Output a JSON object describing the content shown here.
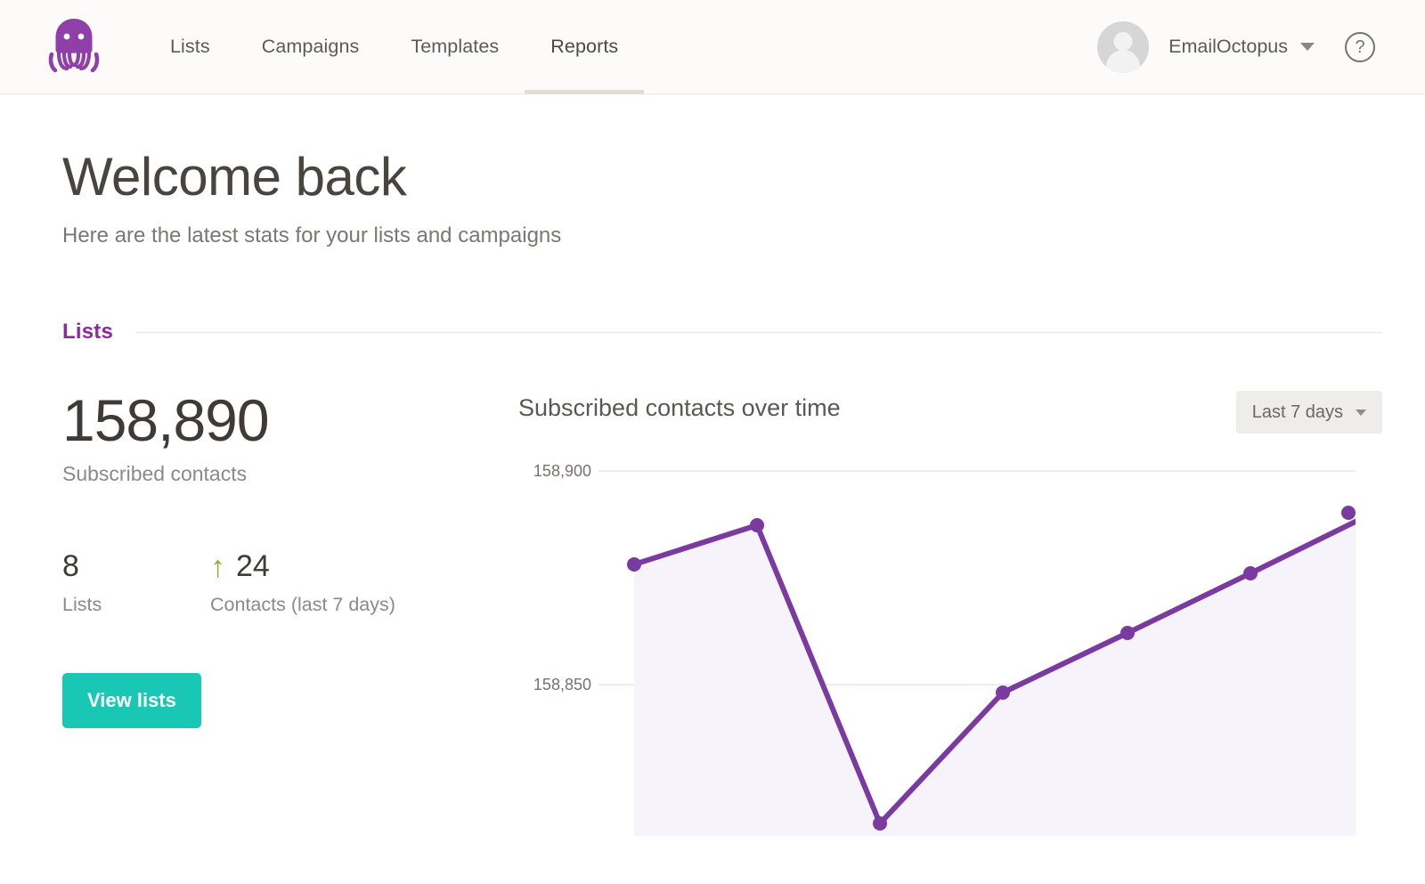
{
  "nav": {
    "logo_icon": "octopus-logo",
    "items": [
      {
        "label": "Lists",
        "active": false
      },
      {
        "label": "Campaigns",
        "active": false
      },
      {
        "label": "Templates",
        "active": false
      },
      {
        "label": "Reports",
        "active": true
      }
    ],
    "account_name": "EmailOctopus",
    "account_caret_icon": "chevron-down-icon",
    "help_icon": "question-mark-icon",
    "avatar_icon": "user-avatar"
  },
  "page": {
    "title": "Welcome back",
    "subtitle": "Here are the latest stats for your lists and campaigns"
  },
  "section": {
    "title": "Lists"
  },
  "stats": {
    "subscribed_value": "158,890",
    "subscribed_label": "Subscribed contacts",
    "lists_value": "8",
    "lists_label": "Lists",
    "contacts_arrow_icon": "arrow-up-icon",
    "contacts_arrow_glyph": "↑",
    "contacts_value": "24",
    "contacts_label": "Contacts (last 7 days)",
    "view_lists_button": "View lists"
  },
  "chart_panel": {
    "title": "Subscribed contacts over time",
    "range_label": "Last 7 days",
    "range_caret_icon": "chevron-down-icon"
  },
  "colors": {
    "brand_purple": "#8e2aa0",
    "line_purple": "#7b3aa0",
    "area_fill": "#f7f3fa",
    "button_teal": "#19c7b5",
    "arrow_green": "#8cb029",
    "topbar_bg": "#fcfbf9",
    "active_tab_underline": "#e3dcd2",
    "gridline": "#e9e6e2"
  },
  "chart_data": {
    "type": "area",
    "title": "Subscribed contacts over time",
    "xlabel": "",
    "ylabel": "",
    "x": [
      1,
      2,
      3,
      4,
      5,
      6,
      7
    ],
    "values": [
      158878,
      158887,
      158817,
      158848,
      158862,
      158876,
      158890
    ],
    "series": [
      {
        "name": "Subscribed contacts",
        "values": [
          158878,
          158887,
          158817,
          158848,
          158862,
          158876,
          158890
        ]
      }
    ],
    "y_ticks": [
      158850,
      158900
    ],
    "y_tick_labels": [
      "158,850",
      "158,900"
    ],
    "ylim": [
      158800,
      158910
    ],
    "grid": true,
    "legend": "none",
    "line_color": "#7b3aa0",
    "fill_color": "#f7f3fa",
    "marker": "circle"
  }
}
